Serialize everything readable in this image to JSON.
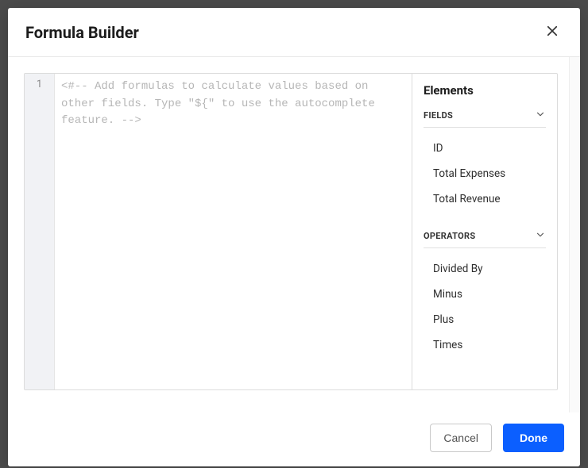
{
  "header": {
    "title": "Formula Builder"
  },
  "editor": {
    "line_number": "1",
    "placeholder": "<#-- Add formulas to calculate values based on other fields. Type \"${\" to use the autocomplete feature. -->"
  },
  "sidebar": {
    "title": "Elements",
    "sections": [
      {
        "label": "FIELDS",
        "items": [
          "ID",
          "Total Expenses",
          "Total Revenue"
        ]
      },
      {
        "label": "OPERATORS",
        "items": [
          "Divided By",
          "Minus",
          "Plus",
          "Times"
        ]
      }
    ]
  },
  "footer": {
    "cancel_label": "Cancel",
    "done_label": "Done"
  }
}
